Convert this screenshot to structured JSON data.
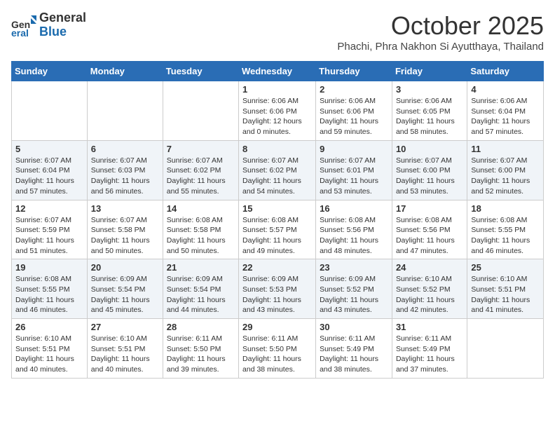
{
  "header": {
    "logo_general": "General",
    "logo_blue": "Blue",
    "month": "October 2025",
    "location": "Phachi, Phra Nakhon Si Ayutthaya, Thailand"
  },
  "days_of_week": [
    "Sunday",
    "Monday",
    "Tuesday",
    "Wednesday",
    "Thursday",
    "Friday",
    "Saturday"
  ],
  "weeks": [
    [
      {
        "day": "",
        "info": ""
      },
      {
        "day": "",
        "info": ""
      },
      {
        "day": "",
        "info": ""
      },
      {
        "day": "1",
        "info": "Sunrise: 6:06 AM\nSunset: 6:06 PM\nDaylight: 12 hours\nand 0 minutes."
      },
      {
        "day": "2",
        "info": "Sunrise: 6:06 AM\nSunset: 6:06 PM\nDaylight: 11 hours\nand 59 minutes."
      },
      {
        "day": "3",
        "info": "Sunrise: 6:06 AM\nSunset: 6:05 PM\nDaylight: 11 hours\nand 58 minutes."
      },
      {
        "day": "4",
        "info": "Sunrise: 6:06 AM\nSunset: 6:04 PM\nDaylight: 11 hours\nand 57 minutes."
      }
    ],
    [
      {
        "day": "5",
        "info": "Sunrise: 6:07 AM\nSunset: 6:04 PM\nDaylight: 11 hours\nand 57 minutes."
      },
      {
        "day": "6",
        "info": "Sunrise: 6:07 AM\nSunset: 6:03 PM\nDaylight: 11 hours\nand 56 minutes."
      },
      {
        "day": "7",
        "info": "Sunrise: 6:07 AM\nSunset: 6:02 PM\nDaylight: 11 hours\nand 55 minutes."
      },
      {
        "day": "8",
        "info": "Sunrise: 6:07 AM\nSunset: 6:02 PM\nDaylight: 11 hours\nand 54 minutes."
      },
      {
        "day": "9",
        "info": "Sunrise: 6:07 AM\nSunset: 6:01 PM\nDaylight: 11 hours\nand 53 minutes."
      },
      {
        "day": "10",
        "info": "Sunrise: 6:07 AM\nSunset: 6:00 PM\nDaylight: 11 hours\nand 53 minutes."
      },
      {
        "day": "11",
        "info": "Sunrise: 6:07 AM\nSunset: 6:00 PM\nDaylight: 11 hours\nand 52 minutes."
      }
    ],
    [
      {
        "day": "12",
        "info": "Sunrise: 6:07 AM\nSunset: 5:59 PM\nDaylight: 11 hours\nand 51 minutes."
      },
      {
        "day": "13",
        "info": "Sunrise: 6:07 AM\nSunset: 5:58 PM\nDaylight: 11 hours\nand 50 minutes."
      },
      {
        "day": "14",
        "info": "Sunrise: 6:08 AM\nSunset: 5:58 PM\nDaylight: 11 hours\nand 50 minutes."
      },
      {
        "day": "15",
        "info": "Sunrise: 6:08 AM\nSunset: 5:57 PM\nDaylight: 11 hours\nand 49 minutes."
      },
      {
        "day": "16",
        "info": "Sunrise: 6:08 AM\nSunset: 5:56 PM\nDaylight: 11 hours\nand 48 minutes."
      },
      {
        "day": "17",
        "info": "Sunrise: 6:08 AM\nSunset: 5:56 PM\nDaylight: 11 hours\nand 47 minutes."
      },
      {
        "day": "18",
        "info": "Sunrise: 6:08 AM\nSunset: 5:55 PM\nDaylight: 11 hours\nand 46 minutes."
      }
    ],
    [
      {
        "day": "19",
        "info": "Sunrise: 6:08 AM\nSunset: 5:55 PM\nDaylight: 11 hours\nand 46 minutes."
      },
      {
        "day": "20",
        "info": "Sunrise: 6:09 AM\nSunset: 5:54 PM\nDaylight: 11 hours\nand 45 minutes."
      },
      {
        "day": "21",
        "info": "Sunrise: 6:09 AM\nSunset: 5:54 PM\nDaylight: 11 hours\nand 44 minutes."
      },
      {
        "day": "22",
        "info": "Sunrise: 6:09 AM\nSunset: 5:53 PM\nDaylight: 11 hours\nand 43 minutes."
      },
      {
        "day": "23",
        "info": "Sunrise: 6:09 AM\nSunset: 5:52 PM\nDaylight: 11 hours\nand 43 minutes."
      },
      {
        "day": "24",
        "info": "Sunrise: 6:10 AM\nSunset: 5:52 PM\nDaylight: 11 hours\nand 42 minutes."
      },
      {
        "day": "25",
        "info": "Sunrise: 6:10 AM\nSunset: 5:51 PM\nDaylight: 11 hours\nand 41 minutes."
      }
    ],
    [
      {
        "day": "26",
        "info": "Sunrise: 6:10 AM\nSunset: 5:51 PM\nDaylight: 11 hours\nand 40 minutes."
      },
      {
        "day": "27",
        "info": "Sunrise: 6:10 AM\nSunset: 5:51 PM\nDaylight: 11 hours\nand 40 minutes."
      },
      {
        "day": "28",
        "info": "Sunrise: 6:11 AM\nSunset: 5:50 PM\nDaylight: 11 hours\nand 39 minutes."
      },
      {
        "day": "29",
        "info": "Sunrise: 6:11 AM\nSunset: 5:50 PM\nDaylight: 11 hours\nand 38 minutes."
      },
      {
        "day": "30",
        "info": "Sunrise: 6:11 AM\nSunset: 5:49 PM\nDaylight: 11 hours\nand 38 minutes."
      },
      {
        "day": "31",
        "info": "Sunrise: 6:11 AM\nSunset: 5:49 PM\nDaylight: 11 hours\nand 37 minutes."
      },
      {
        "day": "",
        "info": ""
      }
    ]
  ]
}
